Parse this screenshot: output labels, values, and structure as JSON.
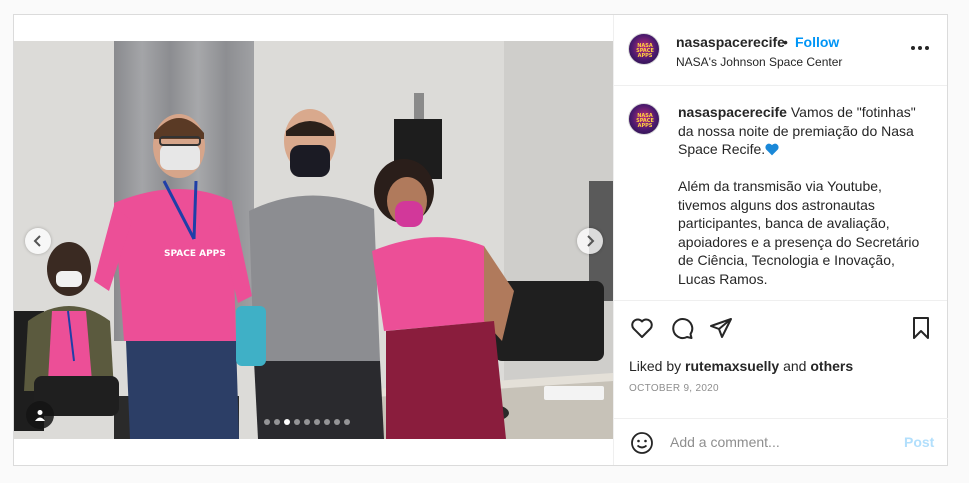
{
  "post": {
    "author": "nasaspacerecife",
    "follow_label": "Follow",
    "separator": "•",
    "location": "NASA's Johnson Space Center",
    "avatar_text": "NASA SPACE APPS",
    "caption": {
      "text": "Vamos de \"fotinhas\" da nossa noite de premiação do Nasa Space Recife.",
      "body": "\n\nAlém da transmisão via Youtube, tivemos alguns dos astronautas participantes, banca de avaliação, apoiadores e a presença do Secretário de Ciência, Tecnologia e Inovação, Lucas Ramos."
    },
    "likes": {
      "prefix": "Liked by",
      "user": "rutemaxsuelly",
      "conjunction": "and",
      "others": "others"
    },
    "date": "OCTOBER 9, 2020",
    "comment_placeholder": "Add a comment...",
    "post_label": "Post",
    "carousel": {
      "total": 9,
      "active": 2
    },
    "colors": {
      "accent": "#0095f6",
      "post_disabled": "#b2dffc",
      "shirt": "#ec4f97"
    },
    "icons": [
      "more-options-icon",
      "like-icon",
      "comment-icon",
      "share-icon",
      "save-icon",
      "emoji-icon",
      "tag-icon",
      "chevron-left-icon",
      "chevron-right-icon",
      "blue-heart-icon"
    ]
  }
}
